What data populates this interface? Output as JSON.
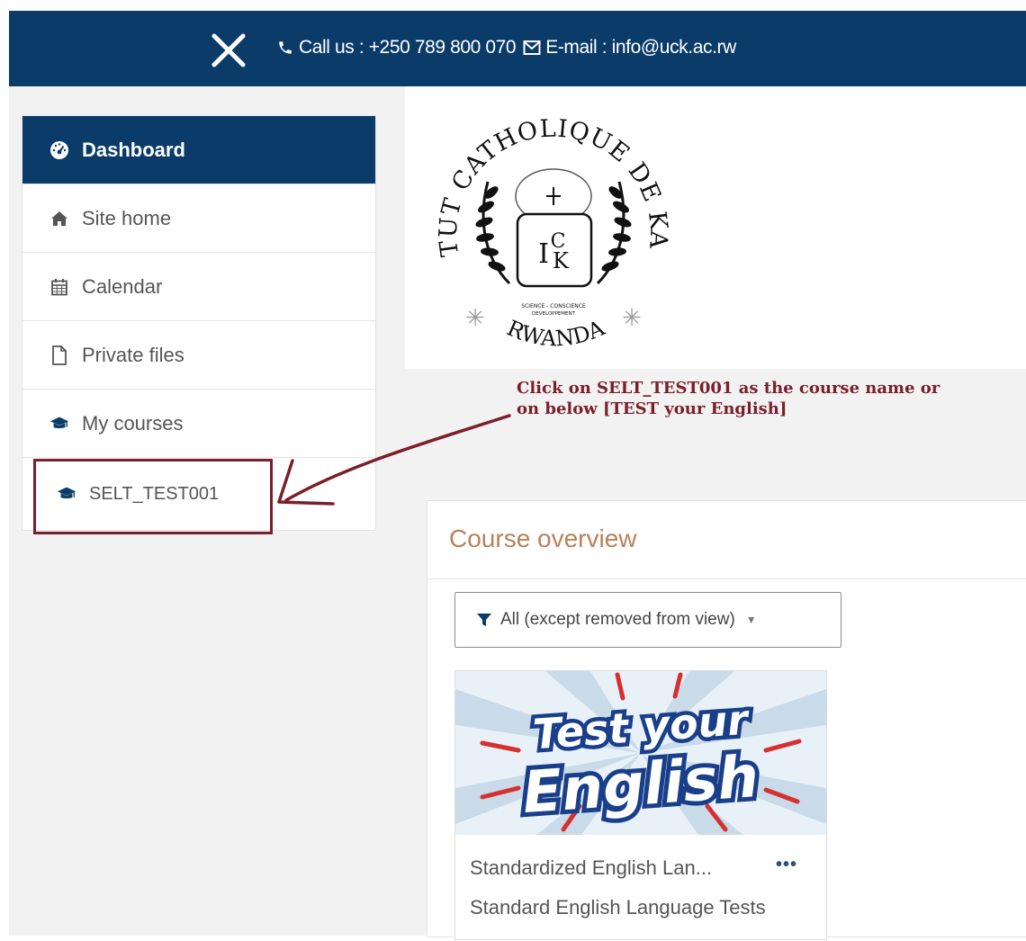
{
  "topbar": {
    "close_icon": "close-icon",
    "phone_icon": "phone-icon",
    "call_text": "Call us : +250 789 800 070",
    "mail_icon": "envelope-icon",
    "email_text": "E-mail : info@uck.ac.rw",
    "background_color": "#0b3b68"
  },
  "sidebar": {
    "items": [
      {
        "label": "Dashboard",
        "icon": "dashboard-icon"
      },
      {
        "label": "Site home",
        "icon": "home-icon"
      },
      {
        "label": "Calendar",
        "icon": "calendar-icon"
      },
      {
        "label": "Private files",
        "icon": "file-icon"
      },
      {
        "label": "My courses",
        "icon": "graduation-cap-icon"
      },
      {
        "label": "SELT_TEST001",
        "icon": "graduation-cap-icon"
      }
    ],
    "active_color": "#0b3b68"
  },
  "logo": {
    "top_text": "INSTITUT CATHOLIQUE DE KABGAYI",
    "monogram_top": "C",
    "monogram_left": "I",
    "monogram_right": "K",
    "motto_line1": "SCIENCE - CONSCIENCE",
    "motto_line2": "DEVELOPPEMENT",
    "bottom_text": "RWANDA"
  },
  "annotation": {
    "line1": "Click on SELT_TEST001 as the course name or",
    "line2": "on below [TEST your English]",
    "color": "#7a1f2b"
  },
  "course_overview": {
    "title": "Course overview",
    "filter_icon": "filter-icon",
    "filter_label": "All (except removed from view)",
    "course": {
      "image_text_line1": "Test your",
      "image_text_line2": "English",
      "name": "Standardized English Lan...",
      "menu_label": "•••",
      "summary": "Standard English Language Tests"
    }
  }
}
